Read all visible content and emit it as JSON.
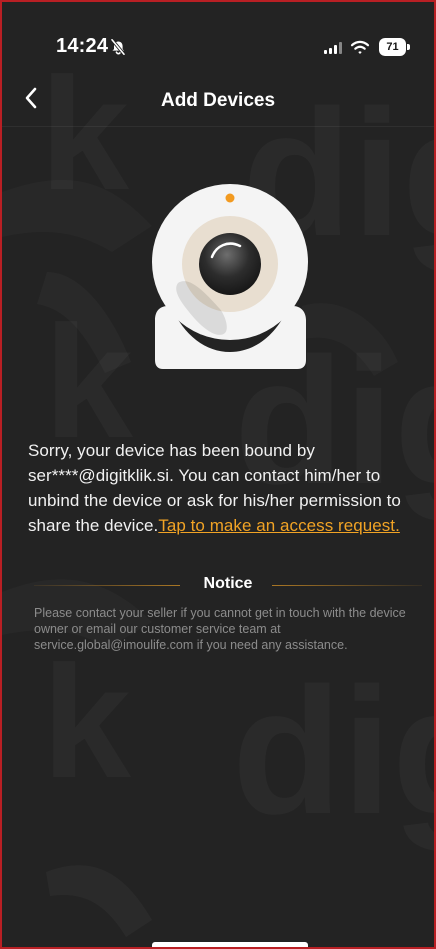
{
  "status_bar": {
    "time": "14:24",
    "battery": "71",
    "icons": [
      "bell-slash-icon",
      "signal-icon",
      "wifi-icon",
      "battery-icon"
    ]
  },
  "navigation": {
    "title": "Add Devices",
    "back_icon": "chevron-left-icon"
  },
  "device_binding": {
    "message": "Sorry, your device has been bound by ser****@digitklik.si. You can contact him/her to unbind the device or ask for his/her permission to share the device.",
    "request_link": "Tap to make an access request."
  },
  "notice": {
    "title": "Notice",
    "text": "Please contact your seller if you cannot get in touch with the device owner or email our customer service team at service.global@imoulife.com if you need any assistance."
  },
  "colors": {
    "background": "#232323",
    "accent": "#f1a325",
    "text": "#f1f1f1",
    "secondary_text": "#8c8c8c"
  }
}
